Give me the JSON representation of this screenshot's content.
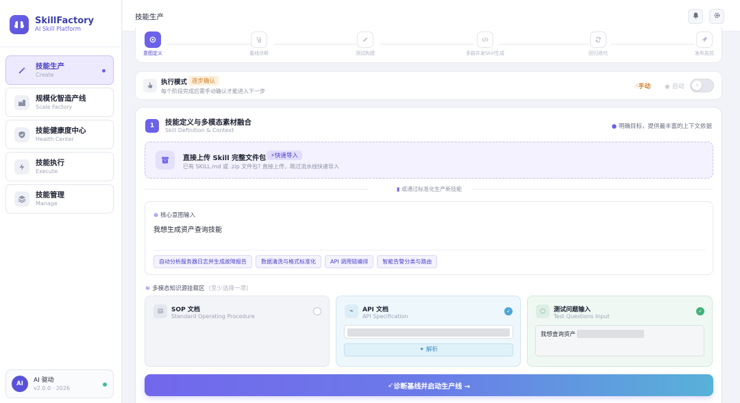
{
  "brand": {
    "name": "SkillFactory",
    "subtitle": "AI Skill Platform",
    "logo_icon": "brain-icon"
  },
  "sidebar": {
    "items": [
      {
        "label": "技能生产",
        "sub": "Create",
        "icon": "wand-icon",
        "active": true
      },
      {
        "label": "规模化智造产线",
        "sub": "Scale Factory",
        "icon": "factory-icon"
      },
      {
        "label": "技能健康度中心",
        "sub": "Health Center",
        "icon": "shield-icon"
      },
      {
        "label": "技能执行",
        "sub": "Execute",
        "icon": "lightning-icon"
      },
      {
        "label": "技能管理",
        "sub": "Manage",
        "icon": "layers-icon"
      }
    ]
  },
  "user": {
    "avatar": "AI",
    "name": "AI 驱动",
    "version": "v2.0.0 · 2026"
  },
  "topbar": {
    "title": "技能生产"
  },
  "pipeline": {
    "steps": [
      {
        "label": "意图定义",
        "icon": "target-icon",
        "active": true
      },
      {
        "label": "基线诊断",
        "icon": "stethoscope-icon"
      },
      {
        "label": "测试构建",
        "icon": "pencil-icon"
      },
      {
        "label": "多路并发Skill生成",
        "icon": "code-icon"
      },
      {
        "label": "回归迭代",
        "icon": "refresh-icon"
      },
      {
        "label": "发布监控",
        "icon": "rocket-icon"
      }
    ]
  },
  "mode": {
    "title": "执行模式",
    "badge": "逐步确认",
    "description": "每个阶段完成后需手动确认才能进入下一步",
    "manual_label": "手动",
    "auto_label": "自动"
  },
  "section": {
    "number": "1",
    "title": "技能定义与多模态素材融合",
    "subtitle": "Skill Definition & Context",
    "hint": "明确目标，提供最丰富的上下文依据"
  },
  "upload": {
    "title": "直接上传 Skill 完整文件包",
    "badge": "快速导入",
    "description": "已有 SKILL.md 或 .zip 文件包? 直接上传，跳过流水线快速导入"
  },
  "divider": {
    "text": "或通过标准化生产新技能"
  },
  "intent": {
    "label": "核心意图输入",
    "value": "我想生成资产查询技能",
    "suggestions": [
      "自动分析服务器日志并生成故障报告",
      "数据清洗与格式标准化",
      "API 调用链编排",
      "智能告警分类与路由"
    ]
  },
  "knowledge": {
    "label": "多模态知识源挂载区",
    "hint": "(至少选择一项)",
    "sources": [
      {
        "title": "SOP 文档",
        "sub": "Standard Operating Procedure",
        "selected": false
      },
      {
        "title": "API 文档",
        "sub": "API Specification",
        "selected": true,
        "button": "解析"
      },
      {
        "title": "测试问题输入",
        "sub": "Test Questions Input",
        "selected": true,
        "input_value": "我想查询资产"
      }
    ]
  },
  "cta": {
    "label": "诊断基线并启动生产线 →"
  },
  "colors": {
    "accent": "#6c62ea",
    "warning": "#d4832a",
    "success": "#3fb27a",
    "info": "#4ea6d6"
  }
}
